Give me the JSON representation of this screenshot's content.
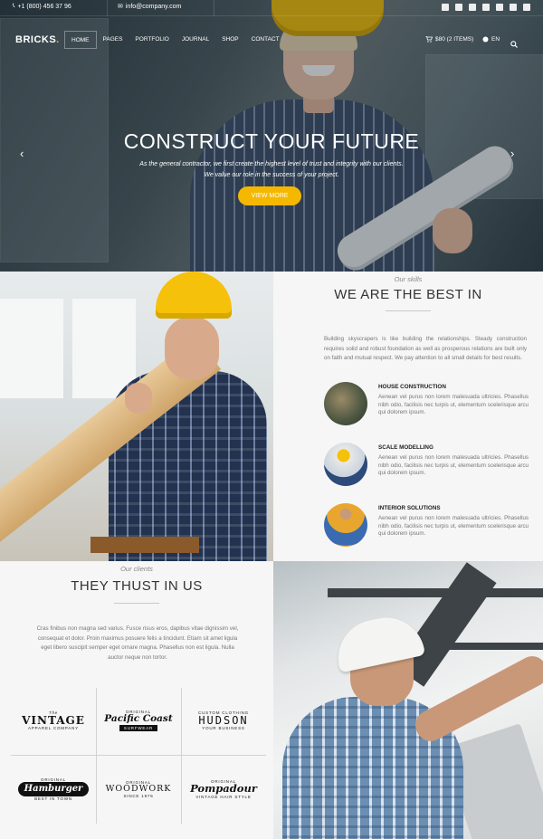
{
  "topbar": {
    "phone": "+1 (800) 456 37 96",
    "email": "info@company.com",
    "social_icons": [
      "facebook-icon",
      "twitter-icon",
      "youtube-icon",
      "instagram-icon",
      "dribbble-icon",
      "flickr-icon",
      "foursquare-icon"
    ]
  },
  "nav": {
    "logo": "BRICKS",
    "logo_dot": ".",
    "items": [
      "HOME",
      "PAGES",
      "PORTFOLIO",
      "JOURNAL",
      "SHOP",
      "CONTACT"
    ],
    "active": "HOME",
    "cart": "$80 (2 ITEMS)",
    "language": "EN"
  },
  "hero": {
    "title": "CONSTRUCT YOUR FUTURE",
    "text": "As the general contractor, we first create the highest level of trust and integrity with our clients. We value our role in the success of your project.",
    "button": "VIEW MORE",
    "prev": "‹",
    "next": "›"
  },
  "skills": {
    "eyebrow": "Our skills",
    "title": "WE ARE THE BEST IN",
    "text": "Building skyscrapers is like building the relationships. Steady construction requires solid and robust foundation as well as prosperous relations are built only on faith and mutual respect. We pay attention to all small details for best results.",
    "services": [
      {
        "title": "HOUSE CONSTRUCTION",
        "text": "Aenean vel purus non lorem malesuada ultricies. Phasellus nibh odio, facilisis nec turpis ut, elementum scelerisque arcu qui dolorem ipsum."
      },
      {
        "title": "SCALE MODELLING",
        "text": "Aenean vel purus non lorem malesuada ultricies. Phasellus nibh odio, facilisis nec turpis ut, elementum scelerisque arcu qui dolorem ipsum."
      },
      {
        "title": "INTERIOR SOLUTIONS",
        "text": "Aenean vel purus non lorem malesuada ultricies. Phasellus nibh odio, facilisis nec turpis ut, elementum scelerisque arcu qui dolorem ipsum."
      }
    ]
  },
  "clients": {
    "eyebrow": "Our clients",
    "title": "THEY THUST IN US",
    "text": "Cras finibus non magna sed varius. Fusce risus eros, dapibus vitae dignissim vel, consequat et dolor. Proin maximus posuere felis a tincidunt. Etiam sit amet ligula eget libero suscipit semper eget ornare magna. Phasellus non est ligula. Nulla auctor neque non tortor.",
    "logos": [
      {
        "top": "The",
        "main": "VINTAGE",
        "bottom": "APPAREL COMPANY"
      },
      {
        "top": "ORIGINAL",
        "main": "Pacific Coast",
        "bottom": "SURFWEAR"
      },
      {
        "top": "CUSTOM CLOTHING",
        "main": "HUDSON",
        "bottom": "YOUR BUSINESS"
      },
      {
        "top": "ORIGINAL",
        "main": "Hamburger",
        "bottom": "BEST IN TOWN"
      },
      {
        "top": "ORIGINAL",
        "main": "WOODWORK",
        "bottom": "SINCE 1976"
      },
      {
        "top": "ORIGINAL",
        "main": "Pompadour",
        "bottom": "VINTAGE HAIR STYLE"
      }
    ]
  },
  "colors": {
    "accent": "#f5b800",
    "dark": "#333333",
    "muted": "#777777"
  }
}
